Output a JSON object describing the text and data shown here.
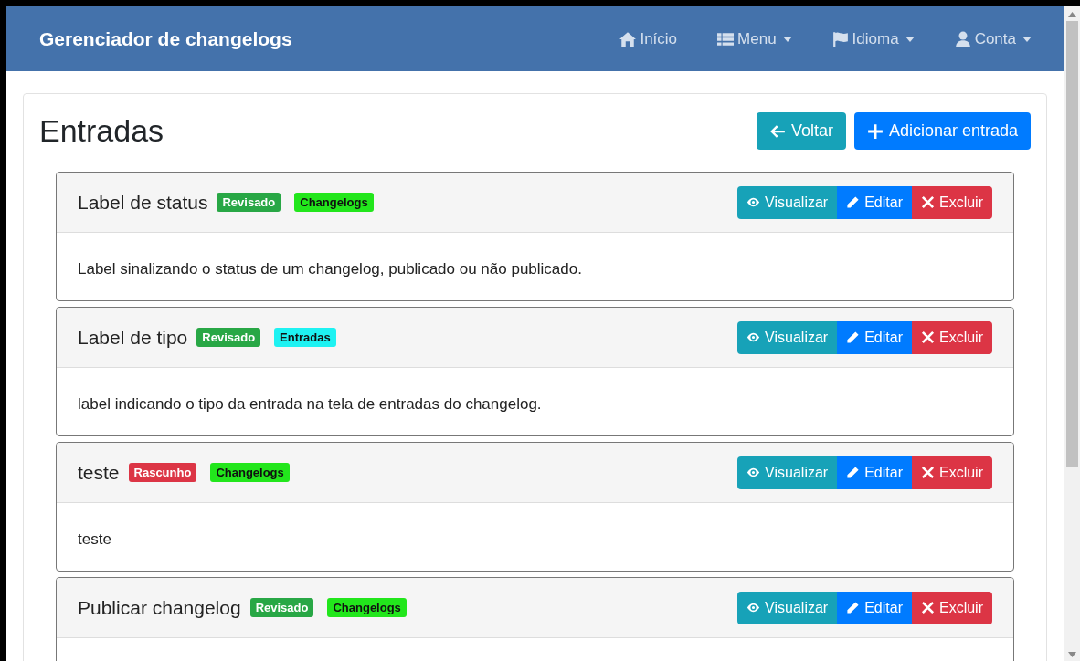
{
  "navbar": {
    "brand": "Gerenciador de changelogs",
    "items": [
      {
        "label": "Início",
        "kind": "home",
        "dropdown": false
      },
      {
        "label": "Menu",
        "kind": "list",
        "dropdown": true
      },
      {
        "label": "Idioma",
        "kind": "flag",
        "dropdown": true
      },
      {
        "label": "Conta",
        "kind": "user",
        "dropdown": true
      }
    ]
  },
  "page": {
    "title": "Entradas",
    "buttons": [
      {
        "label": "Voltar",
        "kind": "back"
      },
      {
        "label": "Adicionar entrada",
        "kind": "add"
      }
    ]
  },
  "entries": [
    {
      "title": "Label de status",
      "status": {
        "label": "Revisado",
        "color": "#28a745"
      },
      "tag": {
        "label": "Changelogs",
        "color": "#22e61c"
      },
      "description": "Label sinalizando o status de um changelog, publicado ou não publicado.",
      "actions": [
        {
          "label": "Visualizar",
          "kind": "view"
        },
        {
          "label": "Editar",
          "kind": "edit"
        },
        {
          "label": "Excluir",
          "kind": "delete"
        }
      ]
    },
    {
      "title": "Label de tipo",
      "status": {
        "label": "Revisado",
        "color": "#28a745"
      },
      "tag": {
        "label": "Entradas",
        "color": "#1ef2f2"
      },
      "description": "label indicando o tipo da entrada na tela de entradas do changelog.",
      "actions": [
        {
          "label": "Visualizar",
          "kind": "view"
        },
        {
          "label": "Editar",
          "kind": "edit"
        },
        {
          "label": "Excluir",
          "kind": "delete"
        }
      ]
    },
    {
      "title": "teste",
      "status": {
        "label": "Rascunho",
        "color": "#dc3545"
      },
      "tag": {
        "label": "Changelogs",
        "color": "#22e61c"
      },
      "description": "teste",
      "actions": [
        {
          "label": "Visualizar",
          "kind": "view"
        },
        {
          "label": "Editar",
          "kind": "edit"
        },
        {
          "label": "Excluir",
          "kind": "delete"
        }
      ]
    },
    {
      "title": "Publicar changelog",
      "status": {
        "label": "Revisado",
        "color": "#28a745"
      },
      "tag": {
        "label": "Changelogs",
        "color": "#22e61c"
      },
      "actions": [
        {
          "label": "Visualizar",
          "kind": "view"
        },
        {
          "label": "Editar",
          "kind": "edit"
        },
        {
          "label": "Excluir",
          "kind": "delete"
        }
      ]
    }
  ]
}
